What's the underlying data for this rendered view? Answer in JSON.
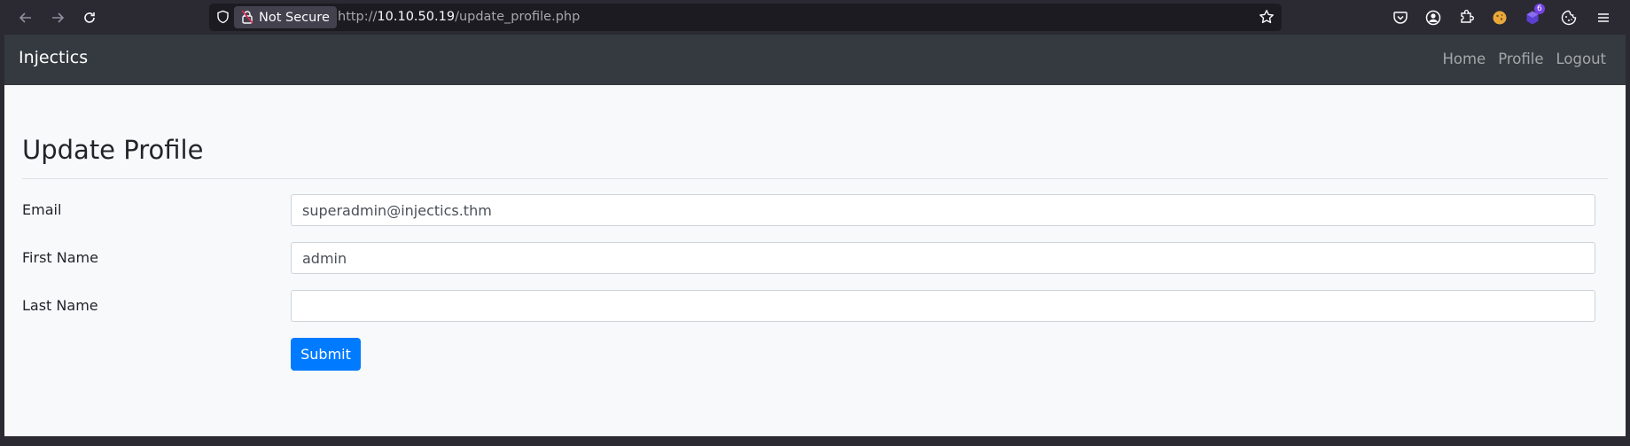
{
  "browser": {
    "security_label": "Not Secure",
    "url_prefix": "http://",
    "url_host": "10.10.50.19",
    "url_path": "/update_profile.php",
    "extension_badge": "6",
    "icons": [
      "back-arrow-icon",
      "forward-arrow-icon",
      "reload-icon",
      "shield-icon",
      "lock-strikethrough-icon",
      "star-icon",
      "pocket-icon",
      "account-icon",
      "extensions-icon",
      "cookie-icon",
      "hamburger-menu-icon"
    ]
  },
  "site": {
    "brand": "Injectics",
    "nav": [
      "Home",
      "Profile",
      "Logout"
    ]
  },
  "form": {
    "title": "Update Profile",
    "email_label": "Email",
    "email_value": "superadmin@injectics.thm",
    "first_name_label": "First Name",
    "first_name_value": "admin",
    "last_name_label": "Last Name",
    "last_name_value": "",
    "submit_label": "Submit"
  },
  "colors": {
    "navbar": "#343a40",
    "primary": "#007bff",
    "page_bg": "#f8f9fa"
  }
}
